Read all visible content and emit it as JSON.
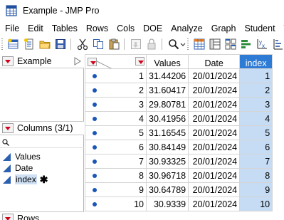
{
  "window": {
    "title": "Example - JMP Pro"
  },
  "menu": [
    "File",
    "Edit",
    "Tables",
    "Rows",
    "Cols",
    "DOE",
    "Analyze",
    "Graph",
    "Student",
    "To"
  ],
  "left_panel": {
    "table_name": "Example",
    "columns_header": "Columns (3/1)",
    "search_placeholder": "",
    "columns": [
      "Values",
      "Date",
      "index"
    ],
    "selected_column_marker": "✱",
    "rows_header": "Rows"
  },
  "grid": {
    "headers": [
      "Values",
      "Date",
      "index"
    ],
    "rows": [
      {
        "n": "1",
        "values": "31.44206",
        "date": "20/01/2024",
        "index": "1"
      },
      {
        "n": "2",
        "values": "31.60417",
        "date": "20/01/2024",
        "index": "2"
      },
      {
        "n": "3",
        "values": "29.80781",
        "date": "20/01/2024",
        "index": "3"
      },
      {
        "n": "4",
        "values": "30.41956",
        "date": "20/01/2024",
        "index": "4"
      },
      {
        "n": "5",
        "values": "31.16545",
        "date": "20/01/2024",
        "index": "5"
      },
      {
        "n": "6",
        "values": "30.84149",
        "date": "20/01/2024",
        "index": "6"
      },
      {
        "n": "7",
        "values": "30.93325",
        "date": "20/01/2024",
        "index": "7"
      },
      {
        "n": "8",
        "values": "30.96718",
        "date": "20/01/2024",
        "index": "8"
      },
      {
        "n": "9",
        "values": "30.64789",
        "date": "20/01/2024",
        "index": "9"
      },
      {
        "n": "10",
        "values": "30.9339",
        "date": "20/01/2024",
        "index": "10"
      }
    ]
  },
  "colors": {
    "selected_header": "#2e7bd6",
    "selected_cells": "#c6dcf4",
    "row_marker": "#1a56b8",
    "red_triangle": "#d0021b"
  }
}
